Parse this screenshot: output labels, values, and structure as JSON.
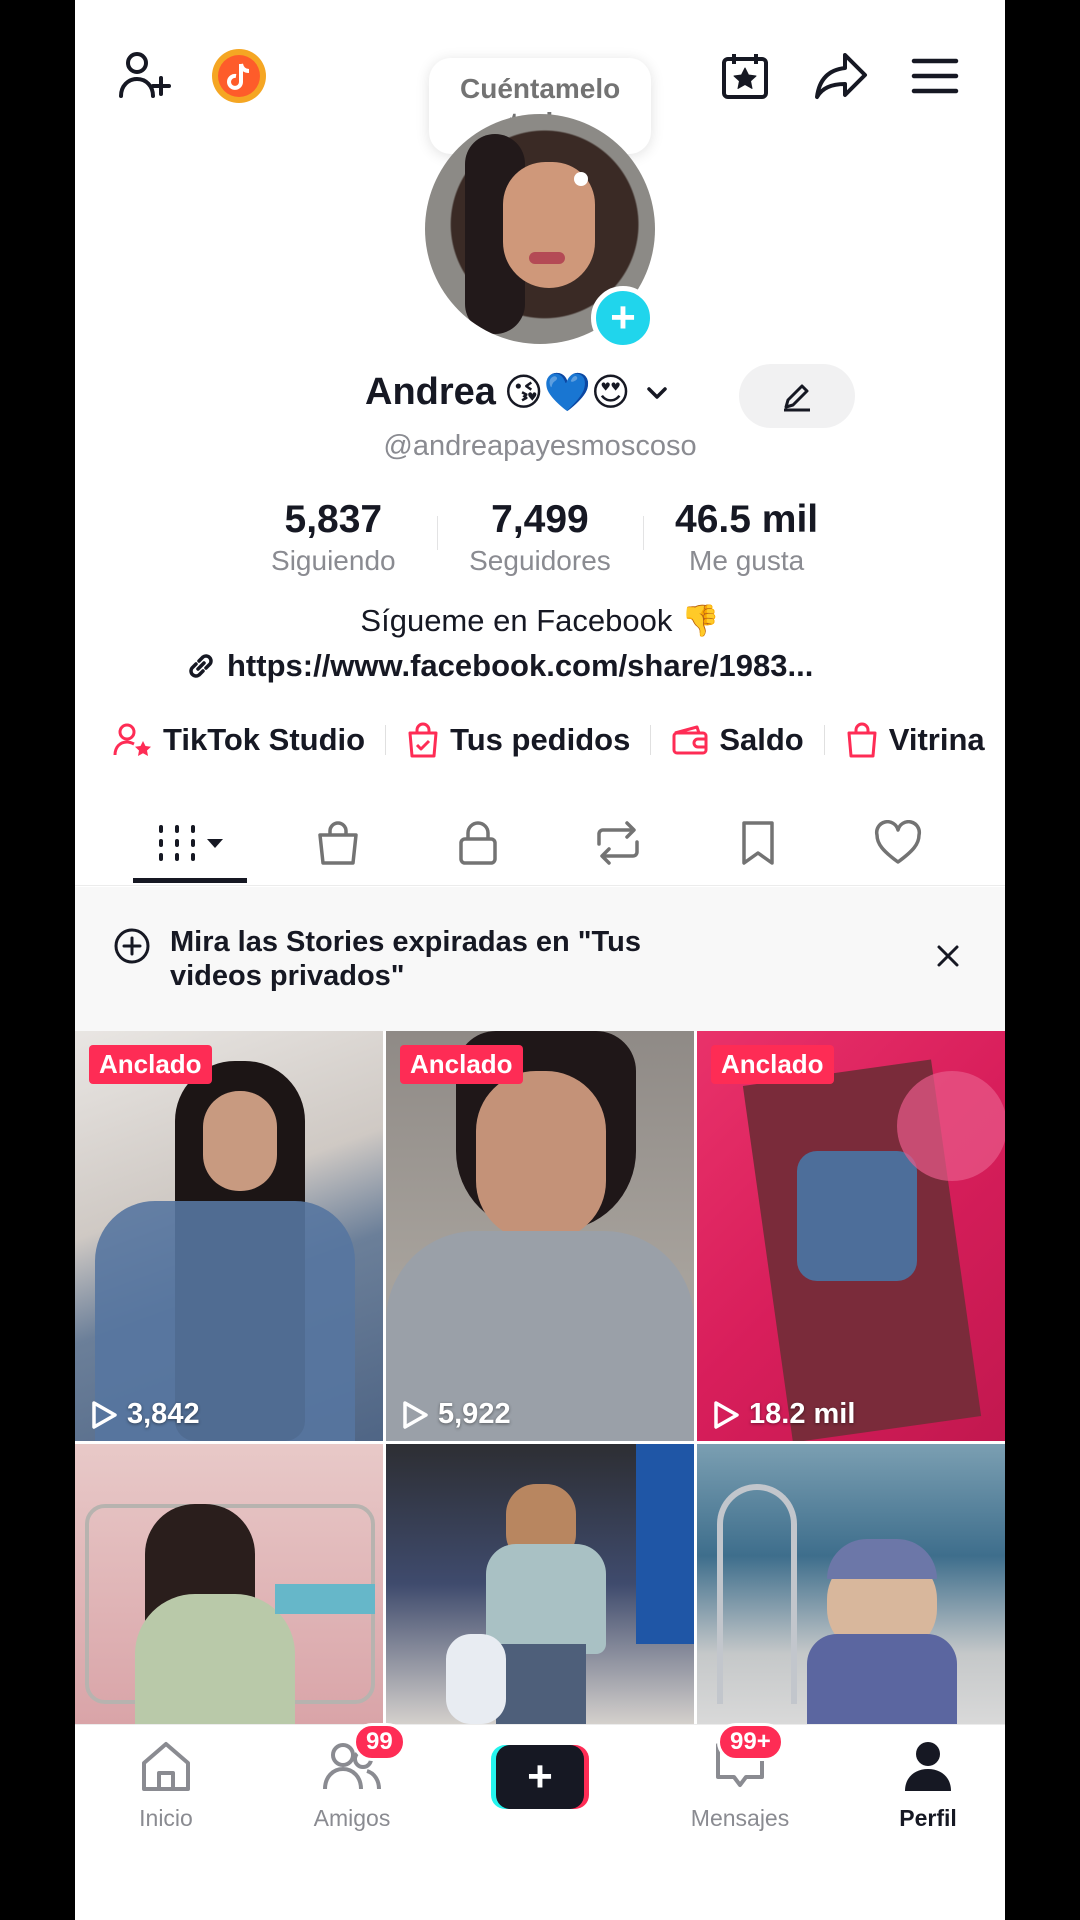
{
  "tooltip": "Cuéntamelo todo",
  "profile": {
    "display_name": "Andrea",
    "name_emojis": "😘💙😍",
    "handle": "@andreapayesmoscoso",
    "bio": "Sígueme en Facebook 👎",
    "link": "https://www.facebook.com/share/1983..."
  },
  "stats": [
    {
      "value": "5,837",
      "label": "Siguiendo"
    },
    {
      "value": "7,499",
      "label": "Seguidores"
    },
    {
      "value": "46.5 mil",
      "label": "Me gusta"
    }
  ],
  "shortcuts": [
    {
      "label": "TikTok Studio",
      "icon": "person-star-icon"
    },
    {
      "label": "Tus pedidos",
      "icon": "bag-check-icon"
    },
    {
      "label": "Saldo",
      "icon": "wallet-icon"
    },
    {
      "label": "Vitrina",
      "icon": "shopping-bag-icon"
    }
  ],
  "tabs": [
    "videos-grid-icon",
    "shop-icon",
    "private-lock-icon",
    "repost-icon",
    "favorites-bookmark-icon",
    "liked-heart-icon"
  ],
  "banner": {
    "text": "Mira las Stories expiradas en \"Tus videos privados\""
  },
  "grid": [
    {
      "pinned": "Anclado",
      "views": "3,842"
    },
    {
      "pinned": "Anclado",
      "views": "5,922"
    },
    {
      "pinned": "Anclado",
      "views": "18.2 mil"
    },
    {
      "pinned": "",
      "views": ""
    },
    {
      "pinned": "",
      "views": ""
    },
    {
      "pinned": "",
      "views": ""
    }
  ],
  "nav": {
    "home": "Inicio",
    "friends": "Amigos",
    "friends_badge": "99",
    "messages": "Mensajes",
    "messages_badge": "99+",
    "profile": "Perfil"
  },
  "colors": {
    "accent": "#fe2c55",
    "cyan": "#25f4ee",
    "text": "#161823",
    "muted": "#8a8b91"
  }
}
